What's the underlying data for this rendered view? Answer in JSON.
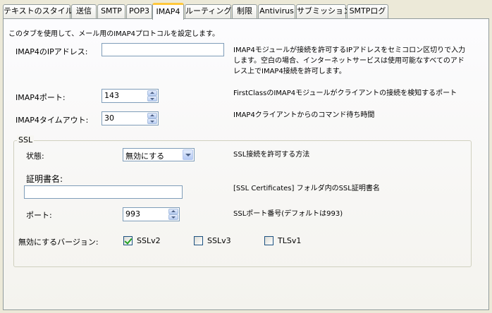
{
  "tabs": [
    {
      "label": "テキストのスタイル",
      "active": false
    },
    {
      "label": "送信",
      "active": false
    },
    {
      "label": "SMTP",
      "active": false
    },
    {
      "label": "POP3",
      "active": false
    },
    {
      "label": "IMAP4",
      "active": true
    },
    {
      "label": "ルーティング",
      "active": false
    },
    {
      "label": "制限",
      "active": false
    },
    {
      "label": "Antivirus",
      "active": false
    },
    {
      "label": "サブミッション",
      "active": false
    },
    {
      "label": "SMTPログ",
      "active": false
    }
  ],
  "intro": "このタブを使用して、メール用のIMAP4プロトコルを設定します。",
  "ip": {
    "label": "IMAP4のIPアドレス:",
    "value": "",
    "description": "IMAP4モジュールが接続を許可するIPアドレスをセミコロン区切りで入力します。空白の場合、インターネットサービスは使用可能なすべてのアドレス上でIMAP4接続を許可します。"
  },
  "port": {
    "label": "IMAP4ポート:",
    "value": "143",
    "description": "FirstClassのIMAP4モジュールがクライアントの接続を検知するポート"
  },
  "timeout": {
    "label": "IMAP4タイムアウト:",
    "value": "30",
    "description": "IMAP4クライアントからのコマンド待ち時間"
  },
  "ssl": {
    "group_title": "SSL",
    "state_label": "状態:",
    "state_value": "無効にする",
    "state_description": "SSL接続を許可する方法",
    "cert_label": "証明書名:",
    "cert_value": "",
    "cert_description": "[SSL Certificates] フォルダ内のSSL証明書名",
    "port_label": "ポート:",
    "port_value": "993",
    "port_description": "SSLポート番号(デフォルトは993)",
    "disable_label": "無効にするバージョン:",
    "versions": [
      {
        "label": "SSLv2",
        "checked": true
      },
      {
        "label": "SSLv3",
        "checked": false
      },
      {
        "label": "TLSv1",
        "checked": false
      }
    ]
  },
  "colors": {
    "accent_tab": "#ffc83c",
    "checkmark": "#21a121",
    "input_border": "#7f9db9"
  }
}
